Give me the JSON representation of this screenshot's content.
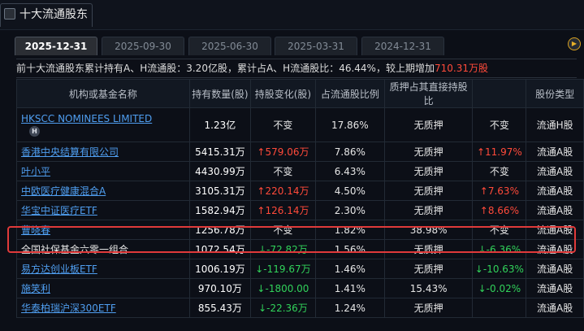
{
  "header": {
    "title": "十大流通股东"
  },
  "tabs": [
    {
      "label": "2025-12-31",
      "active": true
    },
    {
      "label": "2025-09-30",
      "active": false
    },
    {
      "label": "2025-06-30",
      "active": false
    },
    {
      "label": "2025-03-31",
      "active": false
    },
    {
      "label": "2024-12-31",
      "active": false
    }
  ],
  "summary": {
    "prefix": "前十大流通股东累计持有A、H流通股：",
    "shares": "3.20亿股",
    "middle": "，累计占A、H流通股比：",
    "ratio": "46.44%",
    "suffix": "，较上期增加",
    "increase": "710.31万股"
  },
  "table": {
    "columns": [
      "机构或基金名称",
      "持有数量(股)",
      "持股变化(股)",
      "占流通股比例",
      "质押占其直接持股比",
      "",
      "股份类型"
    ],
    "rows": [
      {
        "name": "HKSCC NOMINEES LIMITED",
        "badge": "H",
        "link": true,
        "qty": "1.23亿",
        "change": "不变",
        "change_dir": "none",
        "ratio": "17.86%",
        "pledge": "无质押",
        "pct": "不变",
        "pct_dir": "none",
        "type": "流通H股"
      },
      {
        "name": "香港中央结算有限公司",
        "link": true,
        "qty": "5415.31万",
        "change": "579.06万",
        "change_dir": "up",
        "ratio": "7.86%",
        "pledge": "无质押",
        "pct": "11.97%",
        "pct_dir": "up",
        "type": "流通A股"
      },
      {
        "name": "叶小平",
        "link": true,
        "qty": "4430.99万",
        "change": "不变",
        "change_dir": "none",
        "ratio": "6.43%",
        "pledge": "无质押",
        "pct": "不变",
        "pct_dir": "none",
        "type": "流通A股"
      },
      {
        "name": "中欧医疗健康混合A",
        "link": true,
        "qty": "3105.31万",
        "change": "220.14万",
        "change_dir": "up",
        "ratio": "4.50%",
        "pledge": "无质押",
        "pct": "7.63%",
        "pct_dir": "up",
        "type": "流通A股"
      },
      {
        "name": "华宝中证医疗ETF",
        "link": true,
        "qty": "1582.94万",
        "change": "126.14万",
        "change_dir": "up",
        "ratio": "2.30%",
        "pledge": "无质押",
        "pct": "8.66%",
        "pct_dir": "up",
        "type": "流通A股"
      },
      {
        "name": "曹晓春",
        "link": true,
        "qty": "1256.78万",
        "change": "不变",
        "change_dir": "none",
        "ratio": "1.82%",
        "pledge": "38.98%",
        "pct": "不变",
        "pct_dir": "none",
        "type": "流通A股"
      },
      {
        "name": "全国社保基金六零一组合",
        "link": false,
        "qty": "1072.54万",
        "change": "-72.82万",
        "change_dir": "down",
        "ratio": "1.56%",
        "pledge": "无质押",
        "pct": "-6.36%",
        "pct_dir": "down",
        "type": "流通A股"
      },
      {
        "name": "易方达创业板ETF",
        "link": true,
        "qty": "1006.19万",
        "change": "-119.67万",
        "change_dir": "down",
        "ratio": "1.46%",
        "pledge": "无质押",
        "pct": "-10.63%",
        "pct_dir": "down",
        "type": "流通A股"
      },
      {
        "name": "施笑利",
        "link": true,
        "qty": "970.10万",
        "change": "-1800.00",
        "change_dir": "down",
        "ratio": "1.41%",
        "pledge": "15.43%",
        "pct": "-0.02%",
        "pct_dir": "down",
        "type": "流通A股"
      },
      {
        "name": "华泰柏瑞沪深300ETF",
        "link": true,
        "qty": "855.43万",
        "change": "-22.36万",
        "change_dir": "down",
        "ratio": "1.24%",
        "pledge": "无质押",
        "pct": "",
        "pct_dir": "none",
        "type": "流通A股"
      }
    ]
  },
  "colors": {
    "up": "#ff4a3a",
    "down": "#31d25a",
    "link": "#4f9ef0",
    "highlight": "#e03a3a",
    "active_tab": "#2b2e34"
  },
  "icons": {
    "header": "panel-icon",
    "next": "chevron-right-icon",
    "hk_badge": "hk-badge-icon"
  }
}
